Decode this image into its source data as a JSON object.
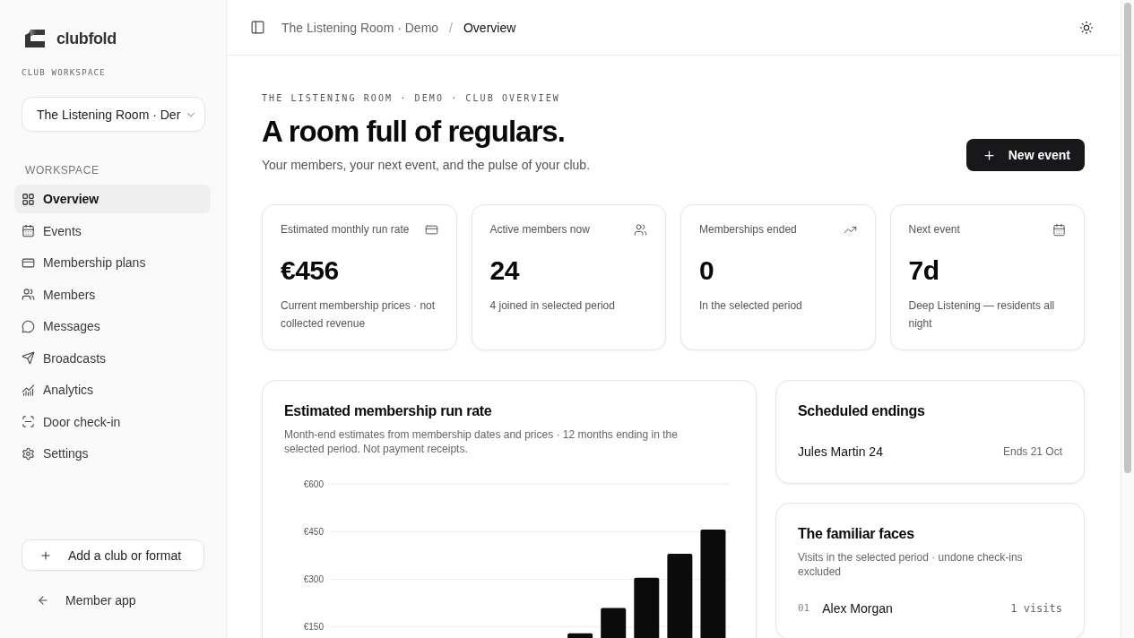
{
  "sidebar": {
    "brand": "clubfold",
    "workspace_label": "CLUB WORKSPACE",
    "club_select": {
      "value": "The Listening Room · Der"
    },
    "section_label": "WORKSPACE",
    "items": [
      {
        "label": "Overview",
        "selected": true
      },
      {
        "label": "Events",
        "selected": false
      },
      {
        "label": "Membership plans",
        "selected": false
      },
      {
        "label": "Members",
        "selected": false
      },
      {
        "label": "Messages",
        "selected": false
      },
      {
        "label": "Broadcasts",
        "selected": false
      },
      {
        "label": "Analytics",
        "selected": false
      },
      {
        "label": "Door check-in",
        "selected": false
      },
      {
        "label": "Settings",
        "selected": false
      }
    ],
    "add_button": {
      "label": "Add a club or format"
    },
    "member_app_link": {
      "label": "Member app"
    }
  },
  "header": {
    "breadcrumb": [
      {
        "label": "The Listening Room · Demo",
        "current": false
      },
      {
        "label": "Overview",
        "current": true
      }
    ],
    "separator": "/"
  },
  "page": {
    "eyebrow": "THE LISTENING ROOM · DEMO · CLUB OVERVIEW",
    "title": "A room full of regulars.",
    "subtitle": "Your members, your next event, and the pulse of your club.",
    "new_event_button": {
      "label": "New event"
    }
  },
  "stats": [
    {
      "label": "Estimated monthly run rate",
      "value": "€456",
      "note": "Current membership prices · not collected revenue"
    },
    {
      "label": "Active members now",
      "value": "24",
      "note": "4 joined in selected period"
    },
    {
      "label": "Memberships ended",
      "value": "0",
      "note": "In the selected period"
    },
    {
      "label": "Next event",
      "value": "7d",
      "note": "Deep Listening — residents all night"
    }
  ],
  "run_rate_card": {
    "title": "Estimated membership run rate",
    "subtitle": "Month-end estimates from membership dates and prices · 12 months ending in the selected period. Not payment receipts.",
    "chart_data": {
      "type": "bar",
      "grid": true,
      "ylim": [
        0,
        600
      ],
      "yticks": [
        {
          "value": 150,
          "label": "€150"
        },
        {
          "value": 300,
          "label": "€300"
        },
        {
          "value": 450,
          "label": "€450"
        },
        {
          "value": 600,
          "label": "€600"
        }
      ],
      "values": [
        null,
        null,
        null,
        null,
        null,
        null,
        null,
        130,
        210,
        305,
        380,
        456
      ]
    }
  },
  "scheduled_endings": {
    "title": "Scheduled endings",
    "rows": [
      {
        "name": "Jules Martin 24",
        "ends": "Ends 21 Oct"
      }
    ]
  },
  "familiar_faces": {
    "title": "The familiar faces",
    "subtitle": "Visits in the selected period · undone check-ins excluded",
    "rows": [
      {
        "rank": "01",
        "name": "Alex Morgan",
        "visits": "1 visits"
      }
    ]
  }
}
